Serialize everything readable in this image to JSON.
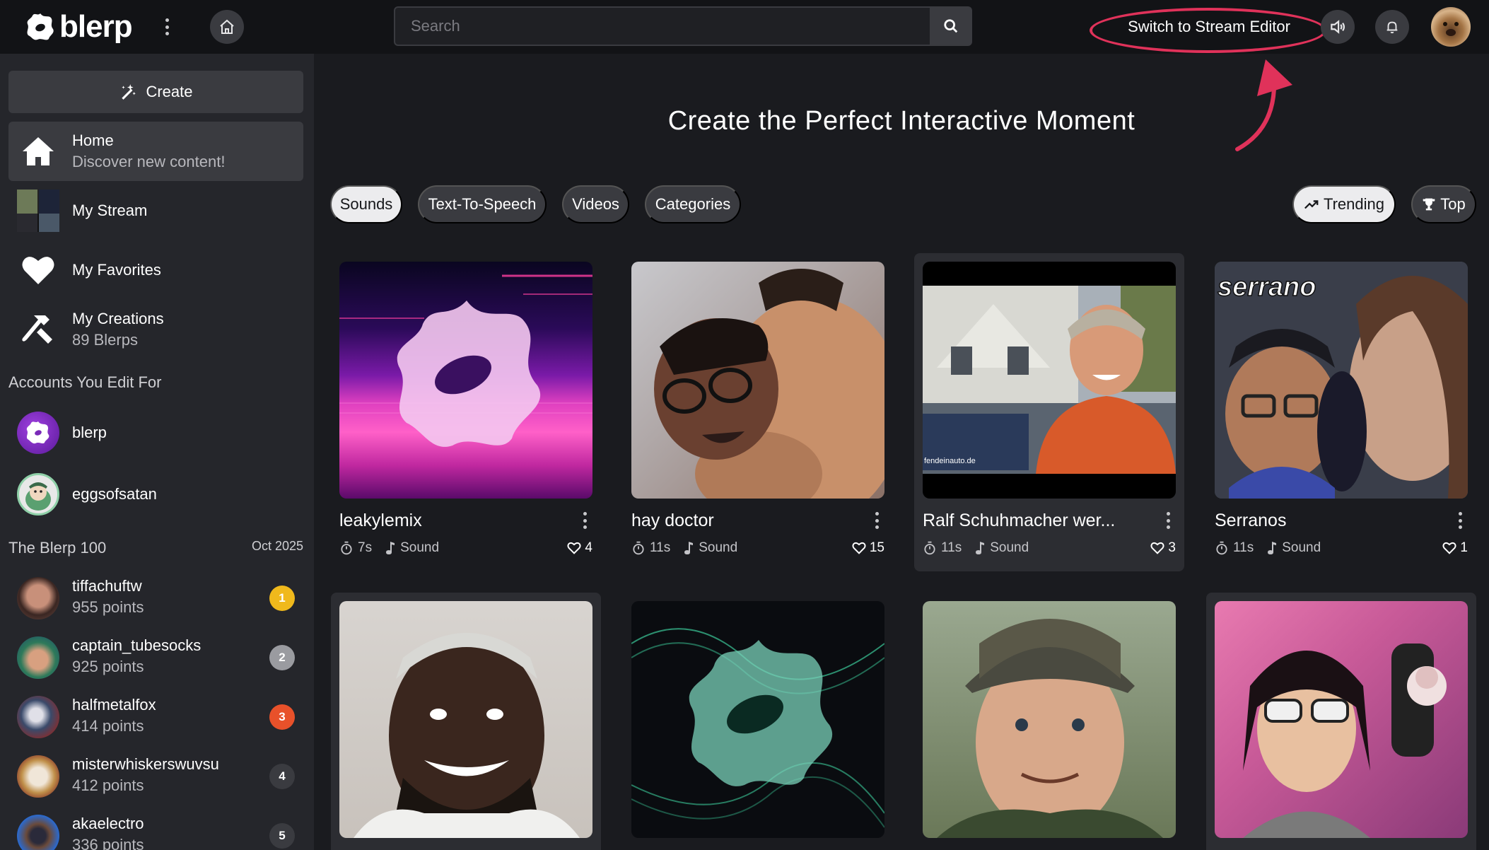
{
  "header": {
    "logo_text": "blerp",
    "search_placeholder": "Search",
    "stream_editor_label": "Switch to Stream Editor"
  },
  "sidebar": {
    "create_label": "Create",
    "nav": [
      {
        "title": "Home",
        "subtitle": "Discover new content!"
      },
      {
        "title": "My Stream",
        "subtitle": ""
      },
      {
        "title": "My Favorites",
        "subtitle": ""
      },
      {
        "title": "My Creations",
        "subtitle": "89 Blerps"
      }
    ],
    "accounts_heading": "Accounts You Edit For",
    "accounts": [
      {
        "name": "blerp"
      },
      {
        "name": "eggsofsatan"
      }
    ],
    "leaderboard_heading": "The Blerp 100",
    "leaderboard_date": "Oct 2025",
    "leaderboard": [
      {
        "name": "tiffachuftw",
        "points": "955 points",
        "rank": "1",
        "color": "#f0b91c"
      },
      {
        "name": "captain_tubesocks",
        "points": "925 points",
        "rank": "2",
        "color": "#9a9ba0"
      },
      {
        "name": "halfmetalfox",
        "points": "414 points",
        "rank": "3",
        "color": "#e8512a"
      },
      {
        "name": "misterwhiskerswuvsu",
        "points": "412 points",
        "rank": "4",
        "color": "#3a3b40"
      },
      {
        "name": "akaelectro",
        "points": "336 points",
        "rank": "5",
        "color": "#3a3b40"
      }
    ]
  },
  "main": {
    "hero_title": "Create the Perfect Interactive Moment",
    "tabs": [
      {
        "label": "Sounds",
        "active": true
      },
      {
        "label": "Text-To-Speech",
        "active": false
      },
      {
        "label": "Videos",
        "active": false
      },
      {
        "label": "Categories",
        "active": false
      }
    ],
    "sort": [
      {
        "label": "Trending",
        "active": true
      },
      {
        "label": "Top",
        "active": false
      }
    ],
    "cards": [
      {
        "title": "leakylemix",
        "duration": "7s",
        "type": "Sound",
        "likes": "4"
      },
      {
        "title": "hay doctor",
        "duration": "11s",
        "type": "Sound",
        "likes": "15"
      },
      {
        "title": "Ralf Schuhmacher wer...",
        "duration": "11s",
        "type": "Sound",
        "likes": "3",
        "thumb_caption": "fendeinauto.de"
      },
      {
        "title": "Serranos",
        "duration": "11s",
        "type": "Sound",
        "likes": "1",
        "thumb_caption": "serrano"
      }
    ],
    "accent_color": "#e0325a"
  }
}
